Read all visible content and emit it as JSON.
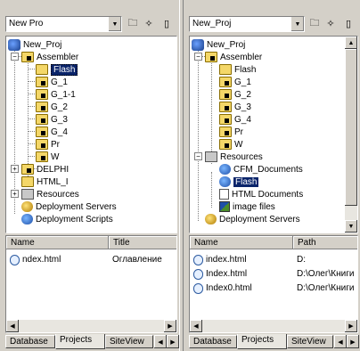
{
  "left": {
    "combo_value": "New Pro",
    "tree": [
      {
        "label": "New_Proj",
        "icon": "project-icon"
      },
      {
        "label": "Assembler",
        "icon": "locked-folder-icon"
      },
      {
        "label": "Flash",
        "icon": "folder-icon",
        "selected": true
      },
      {
        "label": "G_1",
        "icon": "locked-folder-icon"
      },
      {
        "label": "G_1-1",
        "icon": "locked-folder-icon"
      },
      {
        "label": "G_2",
        "icon": "locked-folder-icon"
      },
      {
        "label": "G_3",
        "icon": "locked-folder-icon"
      },
      {
        "label": "G_4",
        "icon": "locked-folder-icon"
      },
      {
        "label": "Pr",
        "icon": "locked-folder-icon"
      },
      {
        "label": "W",
        "icon": "locked-folder-icon"
      },
      {
        "label": "DELPHI",
        "icon": "locked-folder-icon"
      },
      {
        "label": "HTML_I",
        "icon": "folder-icon"
      },
      {
        "label": "Resources",
        "icon": "resources-icon"
      },
      {
        "label": "Deployment Servers",
        "icon": "server-icon"
      },
      {
        "label": "Deployment Scripts",
        "icon": "script-icon"
      }
    ],
    "columns": [
      "Name",
      "Title"
    ],
    "files": [
      {
        "name": "ndex.html",
        "title": "Оглавление"
      }
    ],
    "tabs": [
      "Database",
      "Projects",
      "SiteView"
    ]
  },
  "right": {
    "combo_value": "New_Proj",
    "tree": [
      {
        "label": "New_Proj",
        "icon": "project-icon"
      },
      {
        "label": "Assembler",
        "icon": "locked-folder-icon"
      },
      {
        "label": "Flash",
        "icon": "folder-icon"
      },
      {
        "label": "G_1",
        "icon": "locked-folder-icon"
      },
      {
        "label": "G_2",
        "icon": "locked-folder-icon"
      },
      {
        "label": "G_3",
        "icon": "locked-folder-icon"
      },
      {
        "label": "G_4",
        "icon": "locked-folder-icon"
      },
      {
        "label": "Pr",
        "icon": "locked-folder-icon"
      },
      {
        "label": "W",
        "icon": "locked-folder-icon"
      },
      {
        "label": "Resources",
        "icon": "resources-icon"
      },
      {
        "label": "CFM_Documents",
        "icon": "globe-icon"
      },
      {
        "label": "Flash",
        "icon": "globe-icon",
        "selected": true
      },
      {
        "label": "HTML Documents",
        "icon": "document-icon"
      },
      {
        "label": "image files",
        "icon": "image-icon"
      },
      {
        "label": "Deployment Servers",
        "icon": "server-icon"
      }
    ],
    "columns": [
      "Name",
      "Path"
    ],
    "files": [
      {
        "name": "index.html",
        "path": "D:"
      },
      {
        "name": "Index.html",
        "path": "D:\\Олег\\Книги"
      },
      {
        "name": "Index0.html",
        "path": "D:\\Олег\\Книги"
      }
    ],
    "tabs": [
      "Database",
      "Projects",
      "SiteView"
    ]
  }
}
